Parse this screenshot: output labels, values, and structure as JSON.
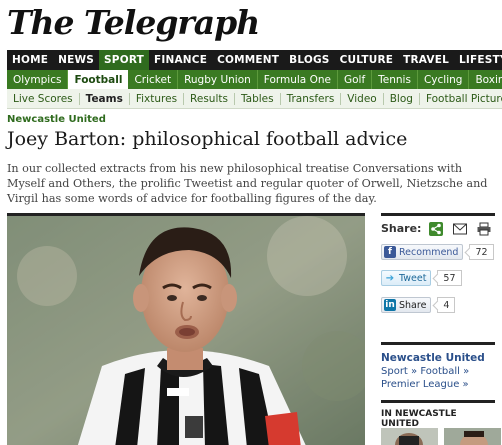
{
  "masthead": {
    "logo_text": "The Telegraph"
  },
  "nav_primary": [
    "HOME",
    "NEWS",
    "SPORT",
    "FINANCE",
    "COMMENT",
    "BLOGS",
    "CULTURE",
    "TRAVEL",
    "LIFESTYLE"
  ],
  "nav_primary_active": "SPORT",
  "nav_sport": [
    "Olympics",
    "Football",
    "Cricket",
    "Rugby Union",
    "Formula One",
    "Golf",
    "Tennis",
    "Cycling",
    "Boxing"
  ],
  "nav_sport_active": "Football",
  "nav_football": [
    "Live Scores",
    "Teams",
    "Fixtures",
    "Results",
    "Tables",
    "Transfers",
    "Video",
    "Blog",
    "Football Pictures"
  ],
  "nav_football_active": "Teams",
  "article": {
    "section": "Newcastle United",
    "headline": "Joey Barton: philosophical football advice",
    "standfirst": "In our collected extracts from his new philosophical treatise Conversations with Myself and Others, the prolific Tweetist and regular quoter of Orwell, Nietzsche and Virgil has some words of advice for footballing figures of the day."
  },
  "share": {
    "label": "Share:",
    "icons": [
      "share-plus-icon",
      "email-icon",
      "print-icon"
    ],
    "facebook": {
      "label": "Recommend",
      "count": "72"
    },
    "twitter": {
      "label": "Tweet",
      "count": "57"
    },
    "linkedin": {
      "label": "Share",
      "count": "4"
    }
  },
  "related": {
    "title": "Newcastle United",
    "links": [
      "Sport »",
      "Football »",
      "Premier League »"
    ]
  },
  "in_section_label": "IN NEWCASTLE UNITED",
  "colors": {
    "sport_green": "#3a7a22",
    "nav_dark": "#1a1a1a",
    "link_blue": "#2a4f8a"
  }
}
